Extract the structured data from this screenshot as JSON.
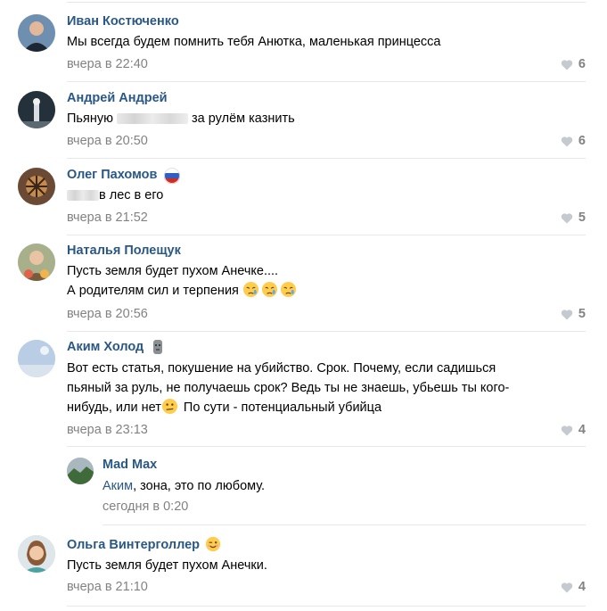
{
  "comments": [
    {
      "author": "Иван Костюченко",
      "lines": [
        "Мы всегда будем помнить тебя Анютка, маленькая принцесса"
      ],
      "date": "вчера в 22:40",
      "likes": "6"
    },
    {
      "author": "Андрей Андрей",
      "text_before": "Пьяную",
      "text_after": "за рулём казнить",
      "date": "вчера в 20:50",
      "likes": "6"
    },
    {
      "author": "Олег Пахомов",
      "text_after": "в лес в его",
      "date": "вчера в 21:52",
      "likes": "5"
    },
    {
      "author": "Наталья Полещук",
      "lines": [
        "Пусть земля будет пухом Анечке....",
        "А родителям сил и терпения"
      ],
      "date": "вчера в 20:56",
      "likes": "5"
    },
    {
      "author": "Аким Холод",
      "lines": [
        "Вот есть статья, покушение на убийство. Срок. Почему, если садишься",
        "пьяный за руль, не получаешь срок? Ведь ты не знаешь, убьешь ты кого-",
        "нибудь, или нет",
        "По сути - потенциальный убийца"
      ],
      "date": "вчера в 23:13",
      "likes": "4"
    },
    {
      "author": "Ольга Винтерголлер",
      "lines": [
        "Пусть земля будет пухом Анечки."
      ],
      "date": "вчера в 21:10",
      "likes": "4"
    }
  ],
  "reply": {
    "author": "Mad Max",
    "reply_to": "Аким",
    "text": ", зона, это по любому.",
    "date": "сегодня в 0:20"
  },
  "colors": {
    "link": "#2a5885",
    "meta": "#828282",
    "separator": "#e7e8ec"
  },
  "icons": [
    "heart-icon",
    "russia-flag-icon",
    "cry-emoji",
    "confused-emoji",
    "wink-emoji",
    "moai-emoji"
  ]
}
